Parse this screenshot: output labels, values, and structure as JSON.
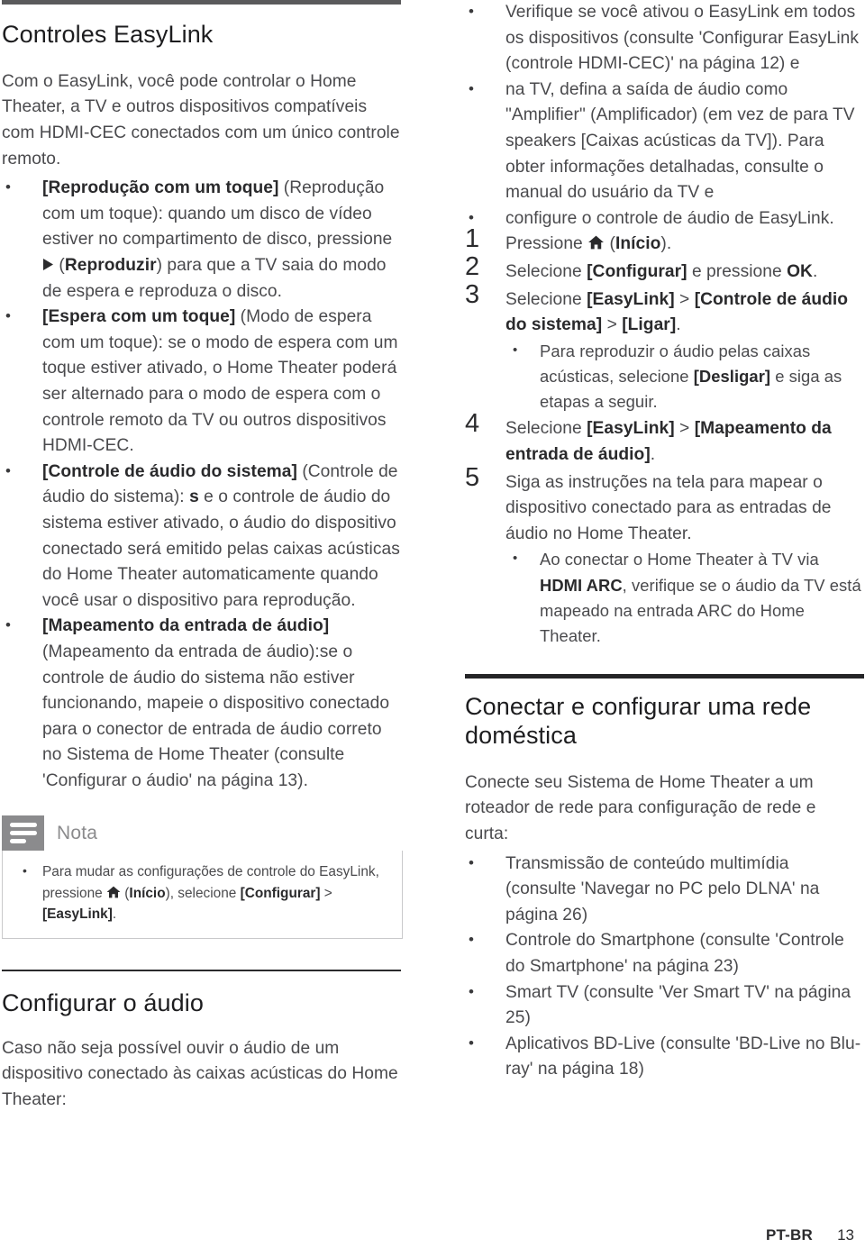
{
  "document": {
    "language_code": "PT-BR",
    "page_number": "13"
  },
  "left_column": {
    "heading": "Controles EasyLink",
    "intro": "Com o EasyLink, você pode controlar o Home Theater, a TV e outros dispositivos compatíveis com HDMI-CEC conectados com um único controle remoto.",
    "bullets": [
      {
        "bold_lead": "[Reprodução com um toque]",
        "text": " (Reprodução com um toque): quando um disco de vídeo estiver no compartimento de disco, pressione ",
        "icon": "play-icon",
        "text_after_icon": " (",
        "bold_mid": "Reproduzir",
        "text_tail": ") para que a TV saia do modo de espera e reproduza o disco."
      },
      {
        "bold_lead": "[Espera com um toque]",
        "text": " (Modo de espera com um toque): se o modo de espera com um toque estiver ativado, o Home Theater poderá ser alternado para o modo de espera com o controle remoto da TV ou outros dispositivos HDMI-CEC."
      },
      {
        "bold_lead": "[Controle de áudio do sistema]",
        "text": " (Controle de áudio do sistema): ",
        "bold_mid": "s",
        "text_tail": " e o controle de áudio do sistema estiver ativado, o áudio do dispositivo conectado será emitido pelas caixas acústicas do Home Theater automaticamente quando você usar o dispositivo para reprodução."
      },
      {
        "bold_lead": "[Mapeamento da entrada de áudio]",
        "text": " (Mapeamento da entrada de áudio):se o controle de áudio do sistema não estiver funcionando, mapeie o dispositivo conectado para o conector de entrada de áudio correto no Sistema de Home Theater (consulte 'Configurar o áudio' na página 13)."
      }
    ],
    "note": {
      "title": "Nota",
      "icon": "note-lines-icon",
      "item_part1": "Para mudar as configurações de controle do EasyLink, pressione ",
      "item_icon": "home-icon",
      "item_part2": " (",
      "item_bold1": "Início",
      "item_part3": "), selecione ",
      "item_bold2": "[Configurar]",
      "item_part4": " > ",
      "item_bold3": "[EasyLink]",
      "item_part5": "."
    },
    "section2": {
      "heading": "Configurar o áudio",
      "intro": "Caso não seja possível ouvir o áudio de um dispositivo conectado às caixas acústicas do Home Theater:"
    }
  },
  "right_column": {
    "top_bullets": [
      "Verifique se você ativou o EasyLink em todos os dispositivos (consulte 'Configurar EasyLink (controle HDMI-CEC)' na página 12) e",
      "na TV, defina a saída de áudio como \"Amplifier\" (Amplificador) (em vez de para TV speakers [Caixas acústicas da TV]). Para obter informações detalhadas, consulte o manual do usuário da TV e",
      "configure o controle de áudio de EasyLink."
    ],
    "steps": [
      {
        "num": "1",
        "part1": "Pressione ",
        "icon": "home-icon",
        "part2": " (",
        "bold1": "Início",
        "part3": ")."
      },
      {
        "num": "2",
        "part1": "Selecione ",
        "bold1": "[Configurar]",
        "part2": " e pressione ",
        "bold2": "OK",
        "part3": "."
      },
      {
        "num": "3",
        "part1": "Selecione ",
        "bold1": "[EasyLink]",
        "part2": " > ",
        "bold2": "[Controle de áudio do sistema]",
        "part3": " > ",
        "bold3": "[Ligar]",
        "part4": ".",
        "sub": [
          {
            "part1": "Para reproduzir o áudio pelas caixas acústicas, selecione ",
            "bold1": "[Desligar]",
            "part2": " e siga as etapas a seguir."
          }
        ]
      },
      {
        "num": "4",
        "part1": "Selecione ",
        "bold1": "[EasyLink]",
        "part2": " > ",
        "bold2": "[Mapeamento da entrada de áudio]",
        "part3": "."
      },
      {
        "num": "5",
        "part1": "Siga as instruções na tela para mapear o dispositivo conectado para as entradas de áudio no Home Theater.",
        "sub": [
          {
            "part1": "Ao conectar o Home Theater à TV via ",
            "bold1": "HDMI ARC",
            "part2": ", verifique se o áudio da TV está mapeado na entrada ARC do Home Theater."
          }
        ]
      }
    ],
    "section2": {
      "heading": "Conectar e configurar uma rede doméstica",
      "intro": "Conecte seu Sistema de Home Theater a um roteador de rede para configuração de rede e curta:",
      "bullets": [
        "Transmissão de conteúdo multimídia (consulte 'Navegar no PC pelo DLNA' na página 26)",
        "Controle do Smartphone (consulte 'Controle do Smartphone' na página 23)",
        "Smart TV (consulte 'Ver Smart TV' na página 25)",
        "Aplicativos BD-Live (consulte 'BD-Live no Blu-ray' na página 18)"
      ]
    }
  },
  "colors": {
    "rule_top": "#5a5a5c",
    "rule_thin": "#2b2b2d",
    "rule_thick": "#252527",
    "note_icon_bg": "#8b8b8d",
    "body_text": "#4a4a4d",
    "heading_text": "#1d1d1f"
  }
}
